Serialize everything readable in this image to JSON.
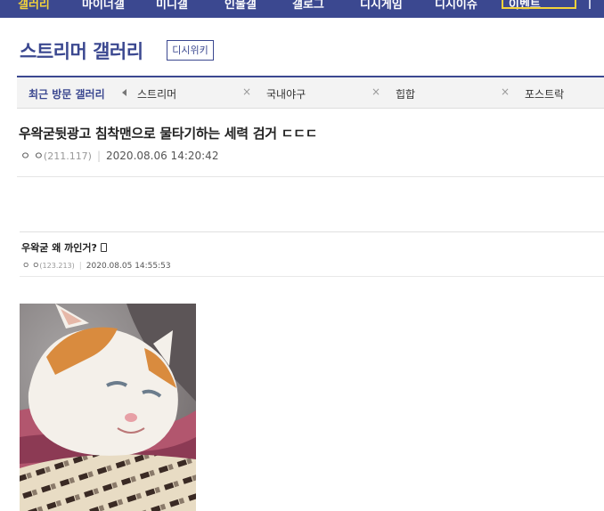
{
  "top_nav": {
    "items": [
      "갤러리",
      "마이너갤",
      "미니갤",
      "인물갤",
      "갤로그",
      "디시게임",
      "디시이슈",
      "이벤트"
    ]
  },
  "gallery": {
    "title": "스트리머 갤러리",
    "wiki_badge": "디시위키"
  },
  "recent_visits": {
    "label": "최근 방문 갤러리",
    "items": [
      "스트리머",
      "국내야구",
      "힙합",
      "포스트락"
    ],
    "close_glyph": "×"
  },
  "post": {
    "title": "우왁굳뒷광고 침착맨으로 물타기하는 세력 검거 ㄷㄷㄷ",
    "author": "ㅇ ㅇ",
    "ip": "(211.117)",
    "datetime": "2020.08.06 14:20:42"
  },
  "quoted_post": {
    "title": "우왁굳 왜 까인거?",
    "author": "ㅇ ㅇ",
    "ip": "(123.213)",
    "datetime": "2020.08.05 14:55:53",
    "device_icon": "mobile-phone-icon"
  },
  "colors": {
    "brand": "#3b4890",
    "highlight": "#f3d33a"
  }
}
